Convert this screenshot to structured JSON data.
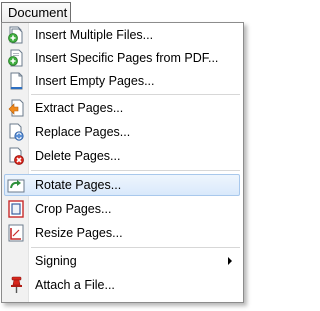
{
  "menubar": {
    "title": "Document"
  },
  "menu": {
    "items": [
      {
        "label": "Insert Multiple Files...",
        "icon": "insert-files-icon"
      },
      {
        "label": "Insert Specific Pages from PDF...",
        "icon": "insert-pdf-pages-icon"
      },
      {
        "label": "Insert Empty Pages...",
        "icon": "insert-empty-page-icon"
      },
      {
        "label": "Extract Pages...",
        "icon": "extract-pages-icon"
      },
      {
        "label": "Replace Pages...",
        "icon": "replace-pages-icon"
      },
      {
        "label": "Delete Pages...",
        "icon": "delete-pages-icon"
      },
      {
        "label": "Rotate Pages...",
        "icon": "rotate-pages-icon",
        "highlighted": true
      },
      {
        "label": "Crop Pages...",
        "icon": "crop-pages-icon"
      },
      {
        "label": "Resize Pages...",
        "icon": "resize-pages-icon"
      },
      {
        "label": "Signing",
        "icon": "none",
        "has_submenu": true
      },
      {
        "label": "Attach a File...",
        "icon": "pushpin-icon"
      }
    ]
  },
  "colors": {
    "highlight_fill": "#d9e9fb",
    "highlight_border": "#a8c8ec",
    "gutter": "#f1f1f1",
    "add_green": "#3fae3f",
    "delete_red": "#d8261c",
    "page_red": "#c82a2a"
  }
}
